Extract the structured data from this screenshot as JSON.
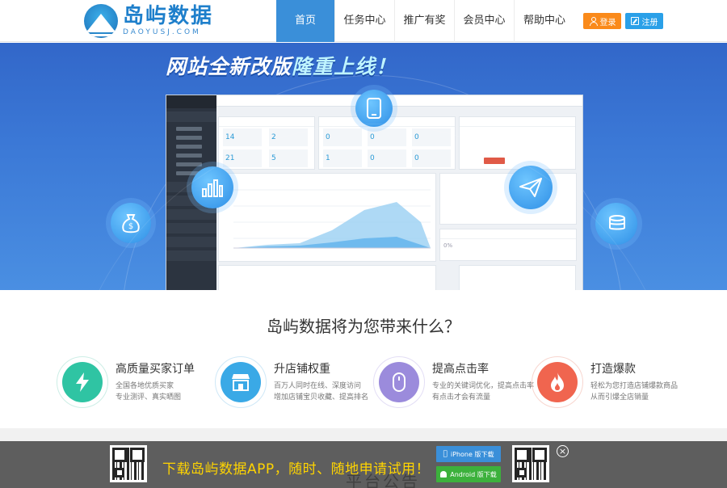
{
  "header": {
    "logo_cn": "岛屿数据",
    "logo_en": "DAOYUSJ.COM",
    "nav": [
      {
        "label": "首页",
        "active": true
      },
      {
        "label": "任务中心",
        "active": false
      },
      {
        "label": "推广有奖",
        "active": false
      },
      {
        "label": "会员中心",
        "active": false
      },
      {
        "label": "帮助中心",
        "active": false
      }
    ],
    "login_label": "登录",
    "register_label": "注册"
  },
  "banner": {
    "title_a": "网站全新改版",
    "title_b": "隆重上线！",
    "mock_stats": [
      "14",
      "2",
      "21",
      "5",
      "0",
      "0",
      "0",
      "1",
      "0",
      "0",
      "0%"
    ]
  },
  "features": {
    "heading": "岛屿数据将为您带来什么？",
    "items": [
      {
        "title": "高质量买家订单",
        "desc1": "全国各地优质买家",
        "desc2": "专业测评、真实晒图",
        "color": "#2fc4a3"
      },
      {
        "title": "升店铺权重",
        "desc1": "百万人同时在线、深度访问",
        "desc2": "增加店铺宝贝收藏、提高排名",
        "color": "#3aa9e6"
      },
      {
        "title": "提高点击率",
        "desc1": "专业的关键词优化，提高点击率",
        "desc2": "有点击才会有流量",
        "color": "#9b8bdc"
      },
      {
        "title": "打造爆款",
        "desc1": "轻松为您打造店铺爆款商品",
        "desc2": "从而引爆全店销量",
        "color": "#f0654f"
      }
    ]
  },
  "appbar": {
    "text": "下载岛屿数据APP，随时、随地申请试用！",
    "iphone_label": "iPhone 版下载",
    "android_label": "Android 版下载",
    "close_label": "×",
    "behind_text": "平台公告"
  }
}
